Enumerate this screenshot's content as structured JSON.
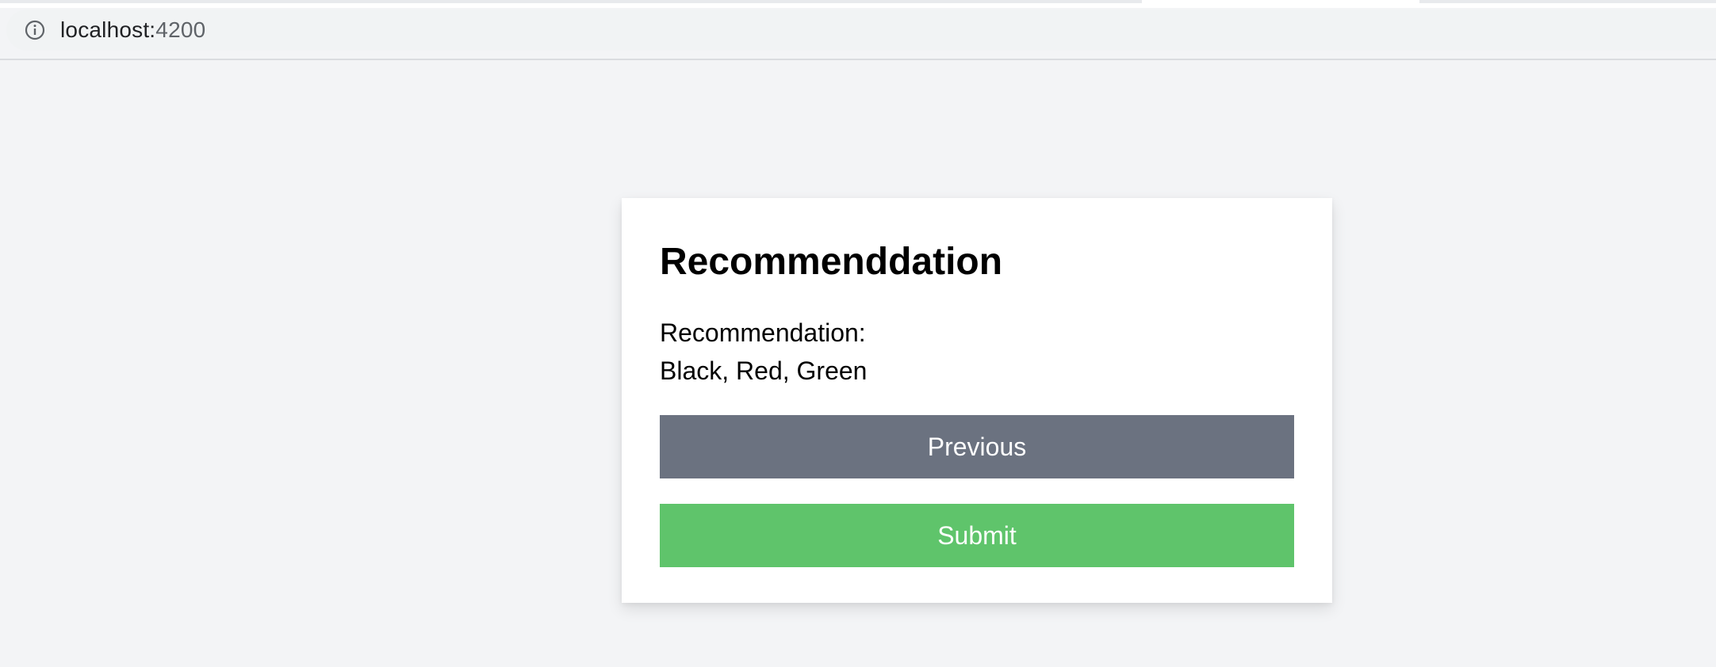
{
  "browser": {
    "url_host": "localhost:",
    "url_port": "4200",
    "info_icon": "info-icon"
  },
  "card": {
    "title": "Recommenddation",
    "label": "Recommendation:",
    "value": "Black, Red, Green",
    "previous_label": "Previous",
    "submit_label": "Submit"
  },
  "colors": {
    "page_background": "#f3f4f6",
    "previous_button": "#6b7280",
    "submit_button": "#5fc46b"
  }
}
